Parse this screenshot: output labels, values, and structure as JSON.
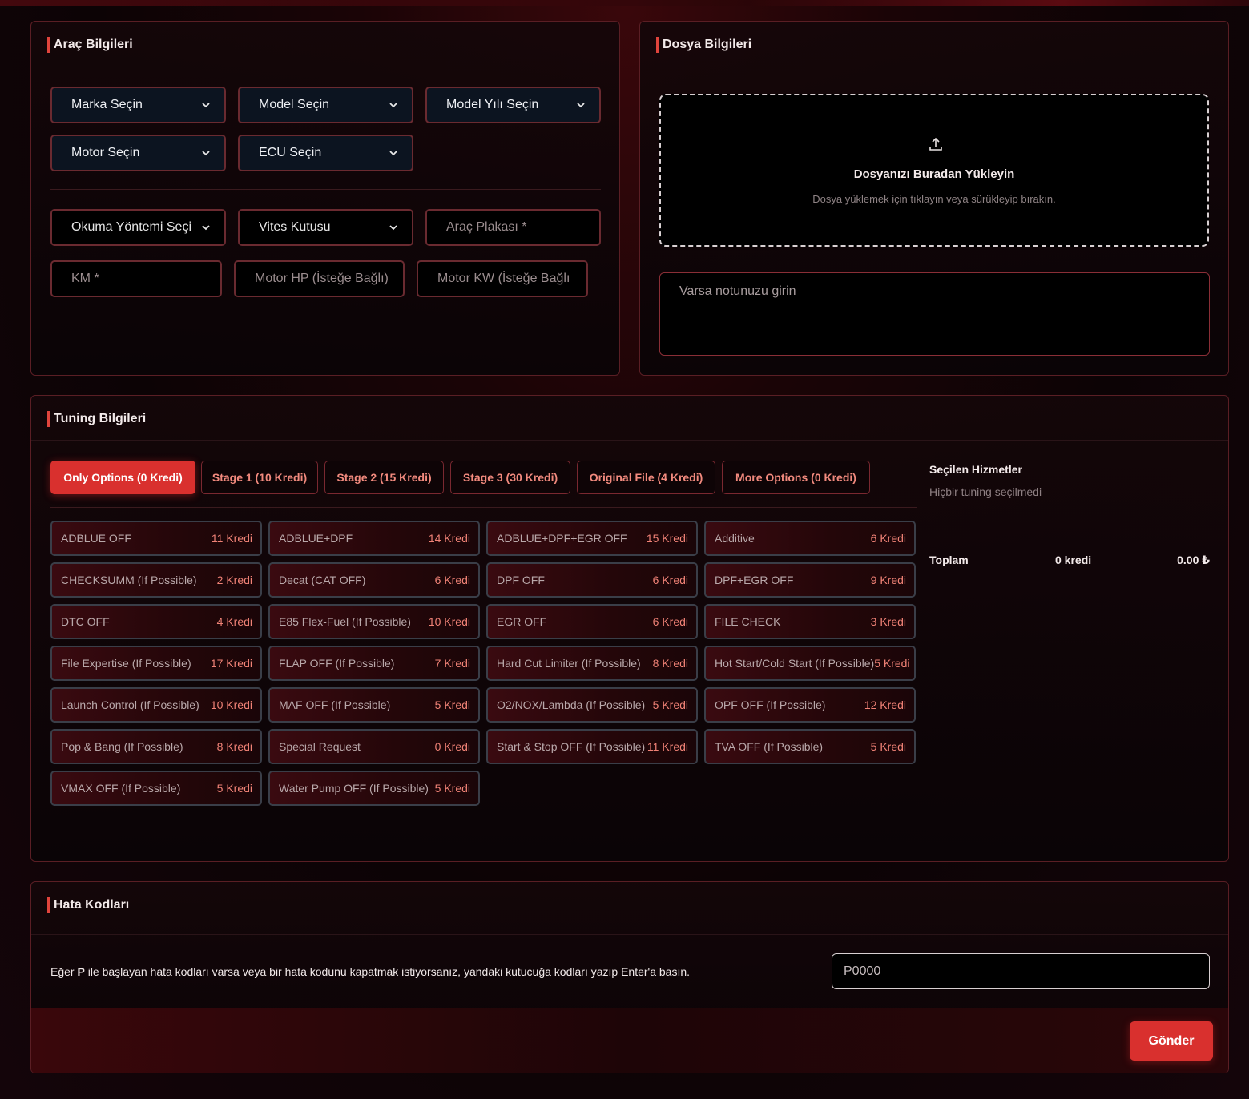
{
  "vehicle": {
    "title": "Araç Bilgileri",
    "brand_select": "Marka Seçin",
    "model_select": "Model Seçin",
    "year_select": "Model Yılı Seçin",
    "engine_select": "Motor Seçin",
    "ecu_select": "ECU Seçin",
    "read_method_select": "Okuma Yöntemi Seçi",
    "gearbox_select": "Vites Kutusu",
    "plate_placeholder": "Araç Plakası *",
    "km_placeholder": "KM *",
    "hp_placeholder": "Motor HP (İsteğe Bağlı)",
    "kw_placeholder": "Motor KW (İsteğe Bağlı"
  },
  "file": {
    "title": "Dosya Bilgileri",
    "upload_icon": "upload-icon",
    "upload_title": "Dosyanızı Buradan Yükleyin",
    "upload_sub": "Dosya yüklemek için tıklayın veya sürükleyip bırakın.",
    "note_placeholder": "Varsa notunuzu girin"
  },
  "tuning": {
    "title": "Tuning Bilgileri",
    "tabs": [
      "Only Options (0 Kredi)",
      "Stage 1 (10 Kredi)",
      "Stage 2 (15 Kredi)",
      "Stage 3 (30 Kredi)",
      "Original File (4 Kredi)",
      "More Options (0 Kredi)"
    ],
    "active_tab": "Only Options (0 Kredi)",
    "options": [
      {
        "name": "ADBLUE OFF",
        "credit": "11 Kredi"
      },
      {
        "name": "ADBLUE+DPF",
        "credit": "14 Kredi"
      },
      {
        "name": "ADBLUE+DPF+EGR OFF",
        "credit": "15 Kredi"
      },
      {
        "name": "Additive",
        "credit": "6 Kredi"
      },
      {
        "name": "CHECKSUMM (If Possible)",
        "credit": "2 Kredi"
      },
      {
        "name": "Decat (CAT OFF)",
        "credit": "6 Kredi"
      },
      {
        "name": "DPF OFF",
        "credit": "6 Kredi"
      },
      {
        "name": "DPF+EGR OFF",
        "credit": "9 Kredi"
      },
      {
        "name": "DTC OFF",
        "credit": "4 Kredi"
      },
      {
        "name": "E85 Flex-Fuel (If Possible)",
        "credit": "10 Kredi"
      },
      {
        "name": "EGR OFF",
        "credit": "6 Kredi"
      },
      {
        "name": "FILE CHECK",
        "credit": "3 Kredi"
      },
      {
        "name": "File Expertise (If Possible)",
        "credit": "17 Kredi"
      },
      {
        "name": "FLAP OFF (If Possible)",
        "credit": "7 Kredi"
      },
      {
        "name": "Hard Cut Limiter (If Possible)",
        "credit": "8 Kredi"
      },
      {
        "name": "Hot Start/Cold Start (If Possible)",
        "credit": "5 Kredi"
      },
      {
        "name": "Launch Control (If Possible)",
        "credit": "10 Kredi"
      },
      {
        "name": "MAF OFF (If Possible)",
        "credit": "5 Kredi"
      },
      {
        "name": "O2/NOX/Lambda (If Possible)",
        "credit": "5 Kredi"
      },
      {
        "name": "OPF OFF (If Possible)",
        "credit": "12 Kredi"
      },
      {
        "name": "Pop & Bang (If Possible)",
        "credit": "8 Kredi"
      },
      {
        "name": "Special Request",
        "credit": "0 Kredi"
      },
      {
        "name": "Start & Stop OFF (If Possible)",
        "credit": "11 Kredi"
      },
      {
        "name": "TVA OFF (If Possible)",
        "credit": "5 Kredi"
      },
      {
        "name": "VMAX OFF (If Possible)",
        "credit": "5 Kredi"
      },
      {
        "name": "Water Pump OFF (If Possible)",
        "credit": "5 Kredi"
      }
    ],
    "summary": {
      "title": "Seçilen Hizmetler",
      "empty": "Hiçbir tuning seçilmedi",
      "total_label": "Toplam",
      "total_credit": "0 kredi",
      "total_price": "0.00 ₺"
    }
  },
  "error_codes": {
    "title": "Hata Kodları",
    "description_prefix": "Eğer ",
    "description_bold": "P",
    "description_suffix": " ile başlayan hata kodları varsa veya bir hata kodunu kapatmak istiyorsanız, yandaki kutucuğa kodları yazıp Enter'a basın.",
    "input_placeholder": "P0000"
  },
  "submit_label": "Gönder",
  "colors": {
    "accent": "#d9302e",
    "border": "#5a1e24",
    "credit_text": "#f08276"
  }
}
